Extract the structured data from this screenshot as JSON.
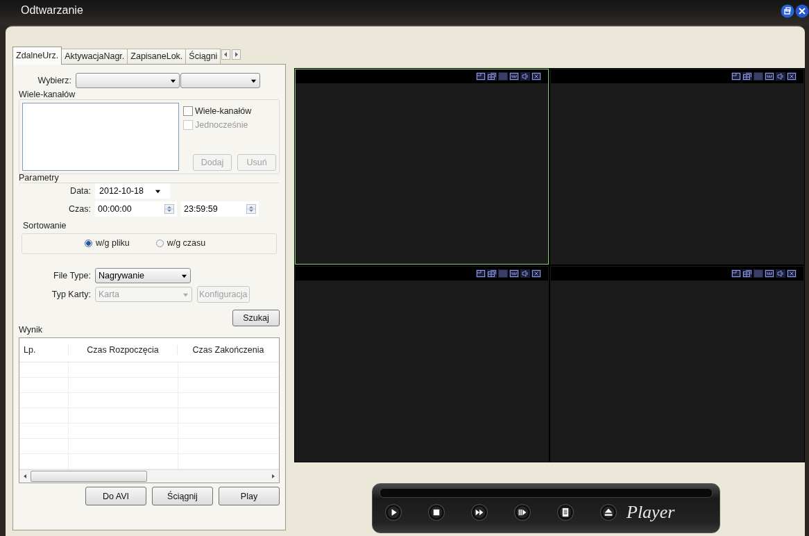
{
  "window": {
    "title": "Odtwarzanie"
  },
  "tabs": [
    {
      "label": "ZdalneUrz.",
      "selected": true
    },
    {
      "label": "AktywacjaNagr.",
      "selected": false
    },
    {
      "label": "ZapisaneLok.",
      "selected": false
    },
    {
      "label": "Ściągni",
      "selected": false
    }
  ],
  "device_select": {
    "label": "Wybierz:"
  },
  "multi_channel": {
    "title": "Wiele-kanałów",
    "options": [
      {
        "label": "Wiele-kanałów",
        "checked": false,
        "disabled": false
      },
      {
        "label": "Jednocześnie",
        "checked": false,
        "disabled": true
      }
    ],
    "buttons": [
      {
        "label": "Dodaj",
        "disabled": true
      },
      {
        "label": "Usuń",
        "disabled": true
      }
    ]
  },
  "parameters": {
    "title": "Parametry",
    "date_label": "Data:",
    "date": "2012-10-18",
    "time_label": "Czas:",
    "time_from": "00:00:00",
    "time_to": "23:59:59",
    "sorting": {
      "title": "Sortowanie",
      "options": [
        {
          "label": "w/g pliku",
          "selected": true
        },
        {
          "label": "w/g czasu",
          "selected": false
        }
      ]
    },
    "file_type": {
      "label": "File Type:",
      "value": "Nagrywanie"
    },
    "card_type": {
      "label": "Typ Karty:",
      "value": "Karta",
      "disabled": true
    },
    "config_button": {
      "label": "Konfiguracja",
      "disabled": true
    }
  },
  "search_button": {
    "label": "Szukaj"
  },
  "results": {
    "title": "Wynik",
    "columns": [
      "Lp.",
      "Czas Rozpoczęcia",
      "Czas Zakończenia"
    ]
  },
  "actions": [
    "Do AVI",
    "Ściągnij",
    "Play"
  ],
  "video_cells": [
    {
      "selected": true
    },
    {
      "selected": false
    },
    {
      "selected": false
    },
    {
      "selected": false
    }
  ],
  "player": {
    "logo": "Player"
  }
}
